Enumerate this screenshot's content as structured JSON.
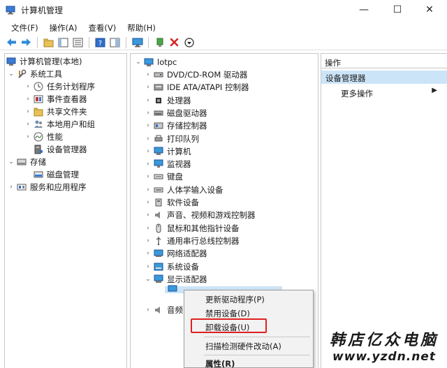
{
  "window": {
    "title": "计算机管理",
    "minimize": "—",
    "maximize": "☐",
    "close": "✕"
  },
  "menu": [
    "文件(F)",
    "操作(A)",
    "查看(V)",
    "帮助(H)"
  ],
  "left_tree": [
    {
      "label": "计算机管理(本地)",
      "icon": "computer-management-icon",
      "chev": ""
    },
    {
      "label": "系统工具",
      "icon": "tools-icon",
      "chev": "v"
    },
    {
      "label": "任务计划程序",
      "icon": "clock-icon",
      "chev": ">"
    },
    {
      "label": "事件查看器",
      "icon": "event-viewer-icon",
      "chev": ">"
    },
    {
      "label": "共享文件夹",
      "icon": "shared-folder-icon",
      "chev": ">"
    },
    {
      "label": "本地用户和组",
      "icon": "users-icon",
      "chev": ">"
    },
    {
      "label": "性能",
      "icon": "performance-icon",
      "chev": ">"
    },
    {
      "label": "设备管理器",
      "icon": "device-manager-icon",
      "chev": ""
    },
    {
      "label": "存储",
      "icon": "storage-icon",
      "chev": "v"
    },
    {
      "label": "磁盘管理",
      "icon": "disk-management-icon",
      "chev": ""
    },
    {
      "label": "服务和应用程序",
      "icon": "services-icon",
      "chev": ">"
    }
  ],
  "device_tree": {
    "root": "lotpc",
    "items": [
      "DVD/CD-ROM 驱动器",
      "IDE ATA/ATAPI 控制器",
      "处理器",
      "磁盘驱动器",
      "存储控制器",
      "打印队列",
      "计算机",
      "监视器",
      "键盘",
      "人体学输入设备",
      "软件设备",
      "声音、视频和游戏控制器",
      "鼠标和其他指针设备",
      "通用串行总线控制器",
      "网络适配器",
      "系统设备",
      "显示适配器"
    ],
    "partial_item": "音频"
  },
  "actions": {
    "header": "操作",
    "selected": "设备管理器",
    "more": "更多操作"
  },
  "context_menu": {
    "update": "更新驱动程序(P)",
    "disable": "禁用设备(D)",
    "uninstall": "卸载设备(U)",
    "scan": "扫描检测硬件改动(A)",
    "properties": "属性(R)"
  },
  "watermark": {
    "cn": "韩店亿众电脑",
    "url": "www.yzdn.net"
  },
  "colors": {
    "selection": "#cce4f7",
    "highlight_box": "#e02020"
  }
}
